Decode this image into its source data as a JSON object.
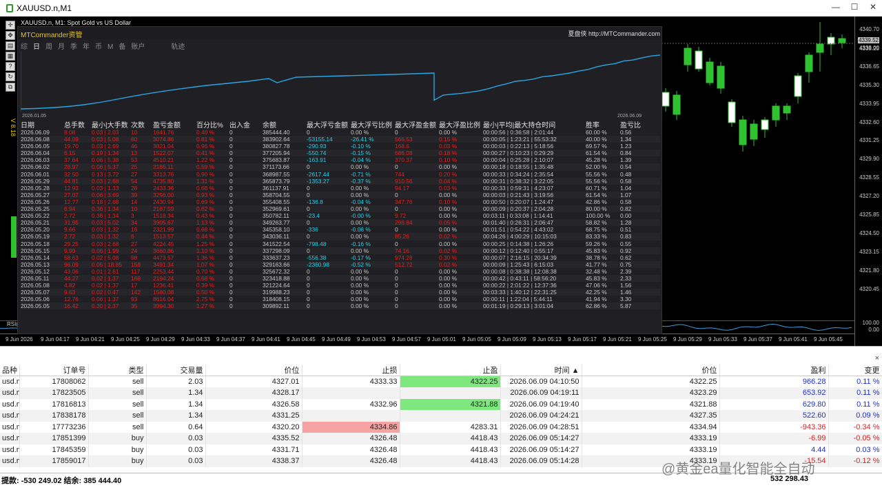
{
  "window": {
    "title": "XAUUSD.n,M1",
    "min": "—",
    "max": "☐",
    "close": "✕"
  },
  "chart": {
    "symbol_line": "XAUUSD.n, M1:  Spot Gold vs US Dollar",
    "side_label": "V 8.18",
    "rsi_label": "RSI(14) 63.28",
    "price_ticks": [
      "4340.70",
      "4338.00",
      "4336.65",
      "4335.30",
      "4333.95",
      "4332.60",
      "4331.25",
      "4329.90",
      "4328.55",
      "4327.20",
      "4325.85",
      "4324.50",
      "4323.15",
      "4321.80",
      "4320.45"
    ],
    "current_price": "4339.52",
    "extra_price": "4339.25",
    "rsi_ticks": [
      "100.00",
      "0.00"
    ],
    "time_ticks": [
      "9 Jun 2026",
      "9 Jun 04:17",
      "9 Jun 04:21",
      "9 Jun 04:25",
      "9 Jun 04:29",
      "9 Jun 04:33",
      "9 Jun 04:37",
      "9 Jun 04:41",
      "9 Jun 04:45",
      "9 Jun 04:49",
      "9 Jun 04:53",
      "9 Jun 04:57",
      "9 Jun 05:01",
      "9 Jun 05:05",
      "9 Jun 05:09",
      "9 Jun 05:13",
      "9 Jun 05:17",
      "9 Jun 05:21",
      "9 Jun 05:25",
      "9 Jun 05:29",
      "9 Jun 05:33",
      "9 Jun 05:37",
      "9 Jun 05:41",
      "9 Jun 05:45"
    ],
    "colors": {
      "bull": "#2fc12f",
      "bear": "#ffffff",
      "equity": "#27a7e6",
      "accent": "#e8c420"
    }
  },
  "mtc": {
    "brand": "MTCommander资管",
    "link": "夏盘侠 http://MTCommander.com",
    "tabs": [
      "综",
      "日",
      "周",
      "月",
      "季",
      "年",
      "币",
      "M",
      "备",
      "账户",
      "轨迹"
    ],
    "active_tab": "日",
    "eq_start": "2026.01.05",
    "eq_end": "2026.06.09",
    "headers": [
      "日期",
      "总手数",
      "最小|大手数",
      "次数",
      "盈亏金额",
      "百分比%",
      "出入金",
      "余额",
      "最大浮亏金额",
      "最大浮亏比例",
      "最大浮盈金额",
      "最大浮盈比例",
      "最小|平均|最大持仓时间",
      "胜率",
      "盈亏比"
    ],
    "rows": [
      [
        "2026.06.09",
        "8.08",
        "0.03 | 2.03",
        "10",
        "1641.76",
        "0.40 %",
        "0",
        "385444.40",
        "0",
        "0.00 %",
        "0",
        "0.00 %",
        "00:00:56 | 0:36:58 | 2:01:44",
        "60.00 %",
        "0.56"
      ],
      [
        "2026.06.08",
        "44.09",
        "0.03 | 5.08",
        "60",
        "3074.86",
        "0.81 %",
        "0",
        "383902.64",
        "-53155.14",
        "-26.41 %",
        "566.53",
        "0.15 %",
        "00:00:05 | 1:23:21 | 55:53:32",
        "40.00 %",
        "1.34"
      ],
      [
        "2026.06.05",
        "19.70",
        "0.03 | 2.69",
        "46",
        "3821.04",
        "0.96 %",
        "0",
        "380827.78",
        "-290.93",
        "-0.10 %",
        "168.6",
        "0.03 %",
        "00:00:03 | 0:22:13 | 5:18:56",
        "69.57 %",
        "1.23"
      ],
      [
        "2026.06.04",
        "6.15",
        "0.19 | 1.34",
        "13",
        "1522.07",
        "0.41 %",
        "0",
        "377205.94",
        "-550.74",
        "-0.15 %",
        "686.08",
        "0.18 %",
        "00:00:27 | 0:10:23 | 0:29:29",
        "61.54 %",
        "0.84"
      ],
      [
        "2026.06.03",
        "37.64",
        "0.06 | 5.38",
        "53",
        "4510.21",
        "1.22 %",
        "0",
        "375683.87",
        "-163.91",
        "-0.04 %",
        "370.37",
        "0.10 %",
        "00:00:04 | 0:25:28 | 2:10:07",
        "45.28 %",
        "1.39"
      ],
      [
        "2026.06.02",
        "28.97",
        "0.06 | 5.37",
        "25",
        "2186.11",
        "0.59 %",
        "0",
        "371173.66",
        "0",
        "0.00 %",
        "0",
        "0.00 %",
        "00:00:18 | 0:18:55 | 1:35:48",
        "52.00 %",
        "0.54"
      ],
      [
        "2026.06.01",
        "32.50",
        "0.13 | 3.72",
        "27",
        "3313.76",
        "0.90 %",
        "0",
        "368987.55",
        "-2617.44",
        "-0.71 %",
        "744",
        "0.20 %",
        "00:00:33 | 0:34:24 | 2:35:54",
        "55.56 %",
        "0.48"
      ],
      [
        "2026.05.29",
        "44.81",
        "0.03 | 2.68",
        "54",
        "4735.80",
        "1.31 %",
        "0",
        "365873.79",
        "-1353.27",
        "-0.37 %",
        "910.56",
        "0.04 %",
        "00:00:31 | 0:38:32 | 3:22:05",
        "55.56 %",
        "0.58"
      ],
      [
        "2026.05.28",
        "12.93",
        "0.03 | 1.33",
        "28",
        "2433.36",
        "0.68 %",
        "0",
        "361137.91",
        "0",
        "0.00 %",
        "94.17",
        "0.03 %",
        "00:00:33 | 0:59:31 | 4:23:07",
        "60.71 %",
        "1.04"
      ],
      [
        "2026.05.27",
        "27.07",
        "0.06 | 3.69",
        "39",
        "3296.00",
        "0.93 %",
        "0",
        "358704.55",
        "0",
        "0.00 %",
        "0",
        "0.00 %",
        "00:00:03 | 0:21:43 | 3:19:56",
        "61.54 %",
        "1.07"
      ],
      [
        "2026.05.26",
        "12.77",
        "0.18 | 2.68",
        "14",
        "2430.94",
        "0.69 %",
        "0",
        "355408.55",
        "-136.8",
        "-0.04 %",
        "347.76",
        "0.10 %",
        "00:00:50 | 0:20:07 | 1:24:47",
        "42.86 %",
        "0.58"
      ],
      [
        "2026.05.25",
        "6.94",
        "0.36 | 1.34",
        "10",
        "2187.59",
        "0.62 %",
        "0",
        "352969.61",
        "0",
        "0.00 %",
        "0",
        "0.00 %",
        "00:00:09 | 0:20:37 | 2:04:28",
        "80.00 %",
        "0.82"
      ],
      [
        "2026.05.22",
        "2.72",
        "0.36 | 1.34",
        "3",
        "1518.34",
        "0.43 %",
        "0",
        "350782.11",
        "-23.4",
        "-0.00 %",
        "9.72",
        "0.00 %",
        "00:03:11 | 0:33:08 | 1:14:41",
        "100.00 %",
        "0.00"
      ],
      [
        "2026.05.21",
        "31.95",
        "0.03 | 5.02",
        "34",
        "3905.67",
        "1.13 %",
        "0",
        "349263.77",
        "0",
        "0.00 %",
        "296.84",
        "0.05 %",
        "00:01:40 | 0:26:31 | 2:06:47",
        "58.82 %",
        "1.28"
      ],
      [
        "2026.05.20",
        "9.66",
        "0.03 | 1.32",
        "16",
        "2321.99",
        "0.68 %",
        "0",
        "345358.10",
        "-336",
        "-0.06 %",
        "0",
        "0.00 %",
        "00:01:51 | 0:54:22 | 4:43:02",
        "68.75 %",
        "0.51"
      ],
      [
        "2026.05.19",
        "2.72",
        "0.03 | 1.32",
        "6",
        "1513.57",
        "0.44 %",
        "0",
        "343036.11",
        "0",
        "0.00 %",
        "85.26",
        "0.02 %",
        "00:04:26 | 4:00:29 | 10:15:03",
        "83.33 %",
        "0.83"
      ],
      [
        "2026.05.18",
        "29.25",
        "0.03 | 2.68",
        "27",
        "4224.45",
        "1.25 %",
        "0",
        "341522.54",
        "-798.48",
        "-0.16 %",
        "0",
        "0.00 %",
        "00:00:25 | 0:14:38 | 1:26:26",
        "59.26 %",
        "0.55"
      ],
      [
        "2026.05.15",
        "9.99",
        "0.06 | 1.99",
        "24",
        "3660.86",
        "1.10 %",
        "0",
        "337298.09",
        "0",
        "0.00 %",
        "74.16",
        "0.02 %",
        "00:00:12 | 0:12:40 | 0:55:17",
        "45.83 %",
        "0.92"
      ],
      [
        "2026.05.14",
        "58.63",
        "0.02 | 5.08",
        "98",
        "4473.57",
        "1.36 %",
        "0",
        "333637.23",
        "-556.38",
        "-0.17 %",
        "974.28",
        "0.30 %",
        "00:00:07 | 2:16:15 | 20:34:39",
        "38.78 %",
        "0.62"
      ],
      [
        "2026.05.13",
        "96.09",
        "0.05 | 18.85",
        "158",
        "3491.34",
        "1.07 %",
        "0",
        "329163.66",
        "-2360.98",
        "-0.52 %",
        "512.72",
        "0.02 %",
        "00:00:09 | 1:25:43 | 6:15:03",
        "41.77 %",
        "0.75"
      ],
      [
        "2026.05.12",
        "43.06",
        "0.01 | 2.61",
        "117",
        "2253.44",
        "0.70 %",
        "0",
        "325672.32",
        "0",
        "0.00 %",
        "0",
        "0.00 %",
        "00:00:08 | 0:38:38 | 12:08:38",
        "32.48 %",
        "2.39"
      ],
      [
        "2026.05.11",
        "44.27",
        "0.02 | 1.37",
        "168",
        "2194.24",
        "0.68 %",
        "0",
        "323418.88",
        "0",
        "0.00 %",
        "0",
        "0.00 %",
        "00:00:42 | 0:43:11 | 58:56:20",
        "45.83 %",
        "2.33"
      ],
      [
        "2026.05.08",
        "4.82",
        "0.02 | 1.37",
        "17",
        "1236.41",
        "0.39 %",
        "0",
        "321224.64",
        "0",
        "0.00 %",
        "0",
        "0.00 %",
        "00:00:22 | 2:01:22 | 12:37:36",
        "47.06 %",
        "1.56"
      ],
      [
        "2026.05.07",
        "9.63",
        "0.02 | 0.47",
        "142",
        "1580.08",
        "0.50 %",
        "0",
        "319988.23",
        "0",
        "0.00 %",
        "0",
        "0.00 %",
        "00:03:33 | 1:40:12 | 22:31:25",
        "42.25 %",
        "1.46"
      ],
      [
        "2026.05.06",
        "12.76",
        "0.06 | 1.37",
        "93",
        "8616.04",
        "2.75 %",
        "0",
        "318408.15",
        "0",
        "0.00 %",
        "0",
        "0.00 %",
        "00:00:11 | 1:22:04 | 5:44:11",
        "41.94 %",
        "3.30"
      ],
      [
        "2026.05.05",
        "16.42",
        "0.30 | 2.37",
        "35",
        "3994.30",
        "1.27 %",
        "0",
        "309892.11",
        "0",
        "0.00 %",
        "0",
        "0.00 %",
        "00:01:19 | 0:29:13 | 3:01:04",
        "62.86 %",
        "5.87"
      ]
    ]
  },
  "orders": {
    "headers": [
      "品种",
      "订单号",
      "类型",
      "交易量",
      "价位",
      "止损",
      "止盈",
      "时间 ▲",
      "价位",
      "盈利",
      "变更"
    ],
    "rows": [
      {
        "sym": "usd.n",
        "id": "17808062",
        "type": "sell",
        "vol": "2.03",
        "price": "4327.01",
        "sl": "4333.33",
        "tp": "4322.25",
        "time": "2026.06.09 04:10:50",
        "cur": "4322.25",
        "profit": "966.28",
        "chg": "0.11 %",
        "tpc": "green",
        "slc": "",
        "neg": false
      },
      {
        "sym": "usd.n",
        "id": "17823505",
        "type": "sell",
        "vol": "1.34",
        "price": "4328.17",
        "sl": "",
        "tp": "",
        "time": "2026.06.09 04:19:11",
        "cur": "4323.29",
        "profit": "653.92",
        "chg": "0.11 %",
        "tpc": "",
        "slc": "",
        "neg": false
      },
      {
        "sym": "usd.n",
        "id": "17816813",
        "type": "sell",
        "vol": "1.34",
        "price": "4326.58",
        "sl": "4332.96",
        "tp": "4321.88",
        "time": "2026.06.09 04:19:40",
        "cur": "4321.88",
        "profit": "629.80",
        "chg": "0.11 %",
        "tpc": "green",
        "slc": "",
        "neg": false
      },
      {
        "sym": "usd.n",
        "id": "17838178",
        "type": "sell",
        "vol": "1.34",
        "price": "4331.25",
        "sl": "",
        "tp": "",
        "time": "2026.06.09 04:24:21",
        "cur": "4327.35",
        "profit": "522.60",
        "chg": "0.09 %",
        "tpc": "",
        "slc": "",
        "neg": false
      },
      {
        "sym": "usd.n",
        "id": "17773236",
        "type": "sell",
        "vol": "0.64",
        "price": "4320.20",
        "sl": "4334.86",
        "tp": "4283.31",
        "time": "2026.06.09 04:28:51",
        "cur": "4334.94",
        "profit": "-943.36",
        "chg": "-0.34 %",
        "tpc": "",
        "slc": "pink",
        "neg": true
      },
      {
        "sym": "usd.n",
        "id": "17851399",
        "type": "buy",
        "vol": "0.03",
        "price": "4335.52",
        "sl": "4326.48",
        "tp": "4418.43",
        "time": "2026.06.09 05:14:27",
        "cur": "4333.19",
        "profit": "-6.99",
        "chg": "-0.05 %",
        "tpc": "",
        "slc": "",
        "neg": true
      },
      {
        "sym": "usd.n",
        "id": "17845359",
        "type": "buy",
        "vol": "0.03",
        "price": "4331.71",
        "sl": "4326.48",
        "tp": "4418.43",
        "time": "2026.06.09 05:14:27",
        "cur": "4333.19",
        "profit": "4.44",
        "chg": "0.03 %",
        "tpc": "",
        "slc": "",
        "neg": false
      },
      {
        "sym": "usd.n",
        "id": "17859017",
        "type": "buy",
        "vol": "0.03",
        "price": "4338.37",
        "sl": "4326.48",
        "tp": "4418.43",
        "time": "2026.06.09 05:14:28",
        "cur": "4333.19",
        "profit": "-15.54",
        "chg": "-0.12 %",
        "tpc": "",
        "slc": "",
        "neg": true
      }
    ],
    "footer": "提款: -530 249.02  结余: 385 444.40",
    "total": "532 298.43",
    "close": "×"
  },
  "watermark": "@黄金ea量化智能全自动"
}
